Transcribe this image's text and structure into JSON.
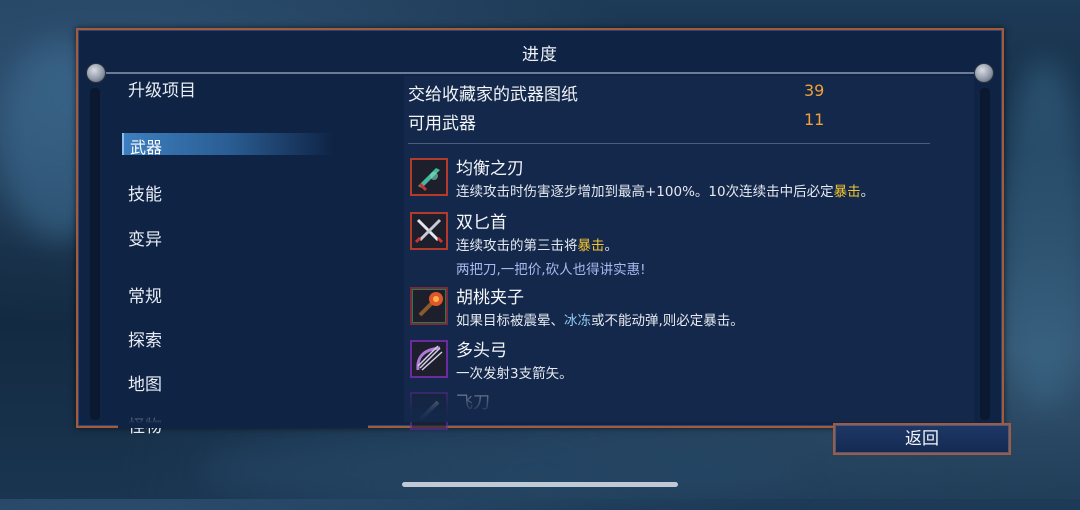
{
  "panel": {
    "title": "进度"
  },
  "sidebar": {
    "header": "升级项目",
    "selected": "武器",
    "items": [
      "技能",
      "变异",
      "常规",
      "探索",
      "地图",
      "怪物"
    ]
  },
  "stats": [
    {
      "label": "交给收藏家的武器图纸",
      "value": "39"
    },
    {
      "label": "可用武器",
      "value": "11"
    }
  ],
  "weapons": [
    {
      "name": "均衡之刃",
      "desc_pre": "连续攻击时伤害逐步增加到最高+100%。10次连续击中后必定",
      "desc_hl": "暴击",
      "desc_post": "。",
      "icon": "balanced-blade-icon"
    },
    {
      "name": "双匕首",
      "desc_pre": "连续攻击的第三击将",
      "desc_hl": "暴击",
      "desc_post": "。",
      "quote": "两把刀,一把价,砍人也得讲实惠!",
      "icon": "twin-daggers-icon"
    },
    {
      "name": "胡桃夹子",
      "desc_pre": "如果目标被震晕、",
      "desc_hl": "冰冻",
      "desc_post": "或不能动弹,则必定暴击。",
      "icon": "nutcracker-icon"
    },
    {
      "name": "多头弓",
      "desc_pre": "一次发射3支箭矢。",
      "icon": "multiple-nocks-bow-icon"
    },
    {
      "name": "飞刀",
      "icon": "throwing-knife-icon"
    }
  ],
  "footer": {
    "back_label": "返回"
  }
}
